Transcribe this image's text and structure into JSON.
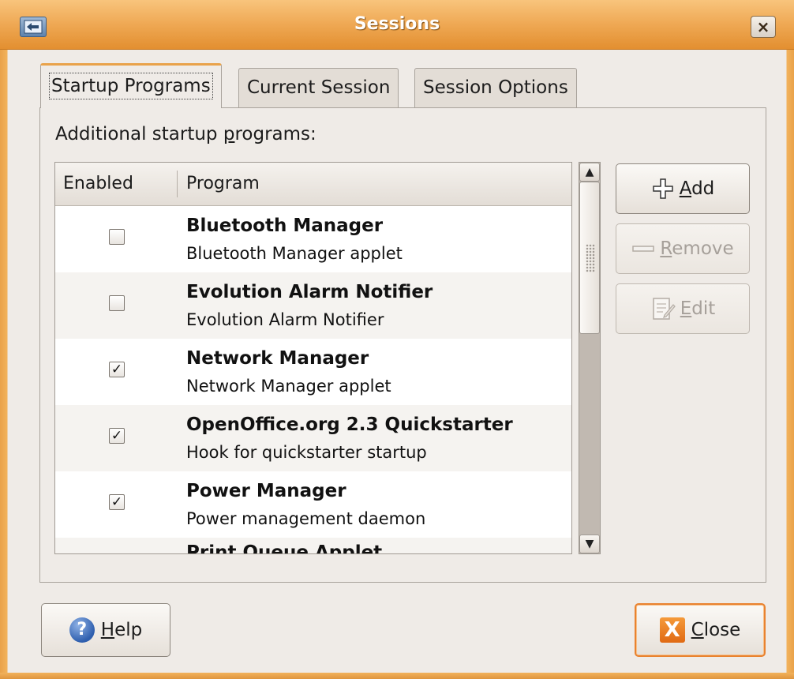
{
  "window": {
    "title": "Sessions",
    "close_glyph": "×"
  },
  "tabs": [
    {
      "label": "Startup Programs",
      "active": true
    },
    {
      "label": "Current Session",
      "active": false
    },
    {
      "label": "Session Options",
      "active": false
    }
  ],
  "startup": {
    "section_label_prefix": "Additional startup ",
    "section_label_mnemonic": "p",
    "section_label_suffix": "rograms:",
    "columns": {
      "enabled": "Enabled",
      "program": "Program"
    },
    "rows": [
      {
        "title": "Bluetooth Manager",
        "subtitle": "Bluetooth Manager applet",
        "checked": false,
        "check_glyph": ""
      },
      {
        "title": "Evolution Alarm Notifier",
        "subtitle": "Evolution Alarm Notifier",
        "checked": false,
        "check_glyph": ""
      },
      {
        "title": "Network Manager",
        "subtitle": "Network Manager applet",
        "checked": true,
        "check_glyph": "✓"
      },
      {
        "title": "OpenOffice.org 2.3 Quickstarter",
        "subtitle": "Hook for quickstarter startup",
        "checked": true,
        "check_glyph": "✓"
      },
      {
        "title": "Power Manager",
        "subtitle": "Power management daemon",
        "checked": true,
        "check_glyph": "✓"
      },
      {
        "title": "Print Queue Applet",
        "subtitle": "",
        "checked": true,
        "check_glyph": ""
      }
    ],
    "scroll": {
      "up_glyph": "▲",
      "down_glyph": "▼"
    },
    "buttons": {
      "add": {
        "mnemonic": "A",
        "rest": "dd",
        "enabled": true
      },
      "remove": {
        "mnemonic": "R",
        "rest": "emove",
        "enabled": false
      },
      "edit": {
        "mnemonic": "E",
        "rest": "dit",
        "enabled": false
      }
    }
  },
  "footer": {
    "help": {
      "mnemonic": "H",
      "rest": "elp",
      "icon_glyph": "?"
    },
    "close": {
      "mnemonic": "C",
      "rest": "lose",
      "icon_glyph": "X"
    }
  },
  "colors": {
    "accent": "#e9a24a",
    "titlebar": "#efa955",
    "dialog_bg": "#efebe7"
  }
}
